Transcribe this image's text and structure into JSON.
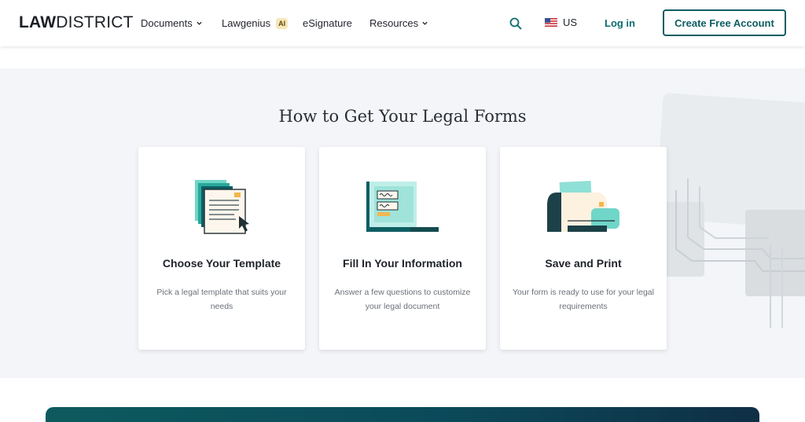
{
  "header": {
    "logo_bold": "LAW",
    "logo_light": "DISTRICT",
    "nav": {
      "documents": "Documents",
      "lawgenius": "Lawgenius",
      "lawgenius_badge": "AI",
      "esignature": "eSignature",
      "resources": "Resources"
    },
    "locale": "US",
    "login": "Log in",
    "cta": "Create Free Account"
  },
  "section": {
    "title": "How to Get Your Legal Forms",
    "cards": [
      {
        "title": "Choose Your Template",
        "description": "Pick a legal template that suits your needs"
      },
      {
        "title": "Fill In Your Information",
        "description": "Answer a few questions to customize your legal document"
      },
      {
        "title": "Save and Print",
        "description": "Your form is ready to use for your legal requirements"
      }
    ]
  },
  "colors": {
    "brand": "#0e5e63",
    "accent_teal": "#6fd6c8",
    "section_bg": "#f3f5f8"
  },
  "icons": [
    "search-icon",
    "us-flag-icon",
    "chevron-down-icon"
  ]
}
